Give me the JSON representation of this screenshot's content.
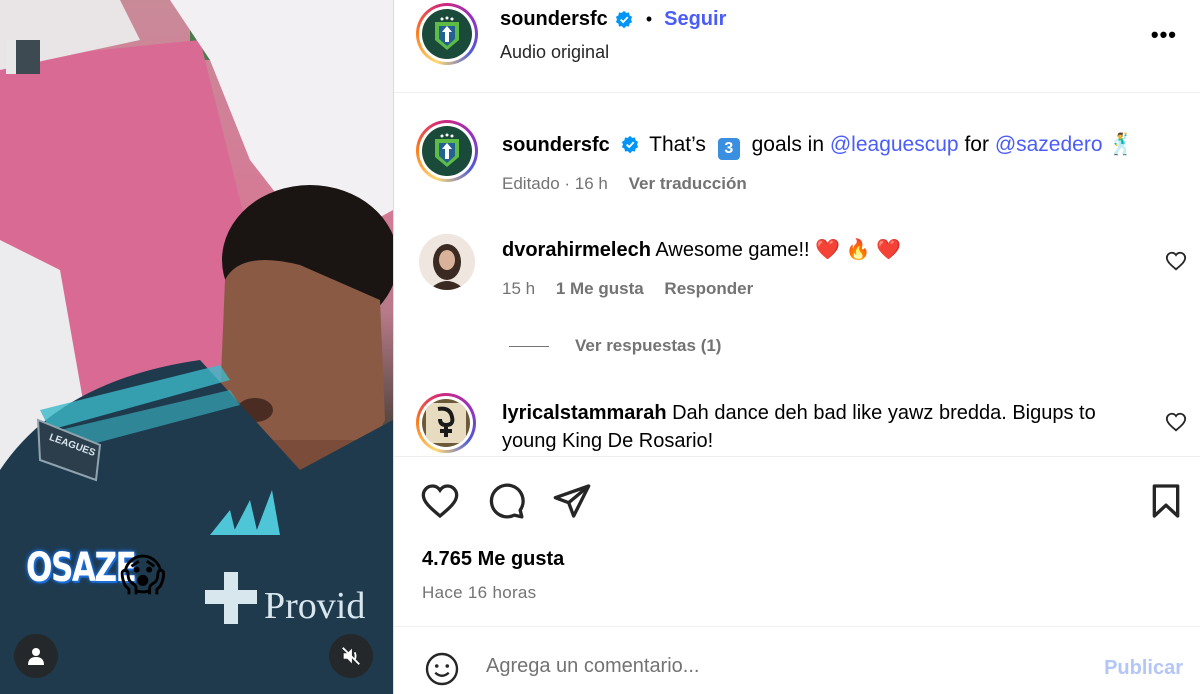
{
  "media": {
    "overlay_text": "OSAZE",
    "overlay_emoji": "😱",
    "sponsor_text": "Provid",
    "badge_text": "LEAGUES",
    "icons": {
      "user": "user-icon",
      "mute": "mute-icon"
    }
  },
  "header": {
    "username": "soundersfc",
    "separator": "•",
    "follow_label": "Seguir",
    "subtitle": "Audio original",
    "more_label": "•••"
  },
  "caption": {
    "username": "soundersfc",
    "text_pre": "That’s",
    "number_emoji": "3",
    "text_mid": "goals in",
    "mention1": "@leaguescup",
    "text_for": "for",
    "mention2": "@sazedero",
    "dance_emoji": "🕺",
    "edited": "Editado",
    "time": "16 h",
    "translate": "Ver traducción"
  },
  "comments": [
    {
      "username": "dvorahirmelech",
      "text": "Awesome game!! ❤️ 🔥 ❤️",
      "time": "15 h",
      "likes": "1 Me gusta",
      "reply": "Responder",
      "view_replies": "Ver respuestas (1)"
    },
    {
      "username": "lyricalstammarah",
      "text": "Dah dance deh bad like yawz bredda. Bigups to young King De Rosario!"
    }
  ],
  "actions": {
    "likes": "4.765 Me gusta",
    "time_ago": "Hace 16 horas"
  },
  "composer": {
    "placeholder": "Agrega un comentario...",
    "publish": "Publicar"
  },
  "colors": {
    "link": "#4a5df9",
    "muted": "#737373",
    "publish_disabled": "#b3c6f7",
    "border": "#dbdbdb",
    "heart": "#e0245e"
  }
}
